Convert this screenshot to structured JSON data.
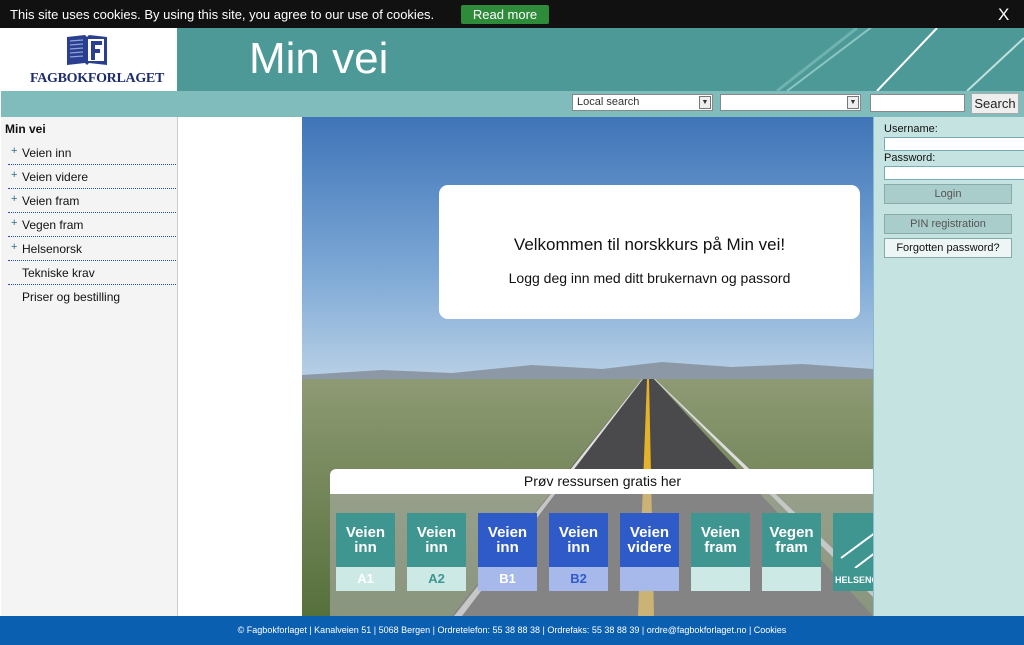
{
  "cookie": {
    "message": "This site uses cookies. By using this site, you agree to our use of cookies.",
    "read_more": "Read more",
    "close": "X"
  },
  "header": {
    "logo_text": "FAGBOKFORLAGET",
    "title": "Min vei"
  },
  "search": {
    "scope_selected": "Local search",
    "category_selected": "",
    "button": "Search"
  },
  "sidebar": {
    "heading": "Min vei",
    "items": [
      {
        "label": "Veien inn",
        "expandable": "+"
      },
      {
        "label": "Veien videre",
        "expandable": "+"
      },
      {
        "label": "Veien fram",
        "expandable": "+"
      },
      {
        "label": "Vegen fram",
        "expandable": "+"
      },
      {
        "label": "Helsenorsk",
        "expandable": "+"
      },
      {
        "label": "Tekniske krav",
        "expandable": ""
      },
      {
        "label": "Priser og bestilling",
        "expandable": ""
      }
    ]
  },
  "welcome": {
    "heading": "Velkommen til norskkurs på Min vei!",
    "text": "Logg deg inn med ditt brukernavn og passord"
  },
  "trial": {
    "title": "Prøv ressursen gratis her",
    "tiles": [
      {
        "line1": "Veien",
        "line2": "inn",
        "level": "A1",
        "color": "#3f9590",
        "bottom": "#cde9e6",
        "level_color": "#ffffff"
      },
      {
        "line1": "Veien",
        "line2": "inn",
        "level": "A2",
        "color": "#3f9590",
        "bottom": "#cde9e6",
        "level_color": "#3f9590"
      },
      {
        "line1": "Veien",
        "line2": "inn",
        "level": "B1",
        "color": "#2f5bc9",
        "bottom": "#a7b9ea",
        "level_color": "#ffffff"
      },
      {
        "line1": "Veien",
        "line2": "inn",
        "level": "B2",
        "color": "#2f5bc9",
        "bottom": "#a7b9ea",
        "level_color": "#2f5bc9"
      },
      {
        "line1": "Veien",
        "line2": "videre",
        "level": "",
        "color": "#2f5bc9",
        "bottom": "#a7b9ea",
        "level_color": "#ffffff"
      },
      {
        "line1": "Veien",
        "line2": "fram",
        "level": "",
        "color": "#3f9590",
        "bottom": "#cde9e6",
        "level_color": "#ffffff"
      },
      {
        "line1": "Vegen",
        "line2": "fram",
        "level": "",
        "color": "#3f9590",
        "bottom": "#cde9e6",
        "level_color": "#ffffff"
      },
      {
        "line1": "",
        "line2": "",
        "level": "HELSENORSK",
        "color": "#3f9590",
        "bottom": "#3f9590",
        "level_color": "#ffffff"
      }
    ]
  },
  "login": {
    "username_label": "Username:",
    "password_label": "Password:",
    "login_button": "Login",
    "pin_button": "PIN registration",
    "forgot_button": "Forgotten password?"
  },
  "footer": {
    "text": "© Fagbokforlaget | Kanalveien 51 | 5068 Bergen | Ordretelefon: 55 38 88 38 | Ordrefaks: 55 38 88 39 | ordre@fagbokforlaget.no | Cookies"
  }
}
